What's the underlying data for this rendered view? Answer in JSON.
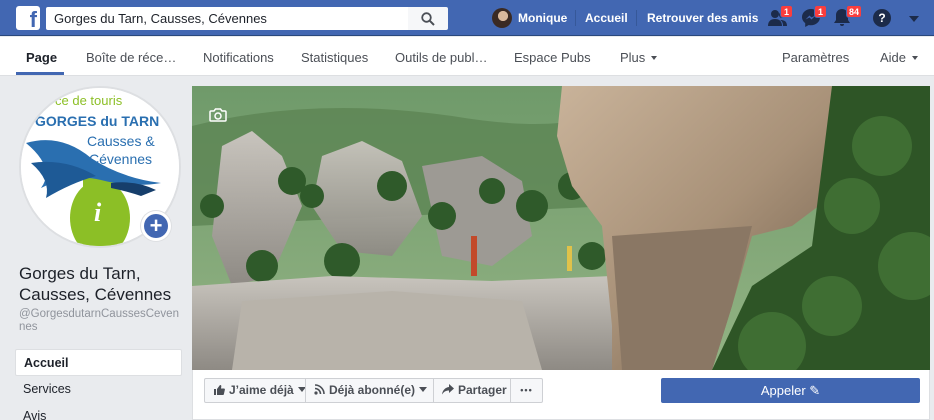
{
  "topbar": {
    "logo": "f",
    "search_value": "Gorges du Tarn, Causses, Cévennes",
    "user_name": "Monique",
    "home_label": "Accueil",
    "find_friends_label": "Retrouver des amis",
    "friend_requests_count": "1",
    "messages_count": "1",
    "notifications_count": "84",
    "help_symbol": "?"
  },
  "tabs": [
    {
      "label": "Page"
    },
    {
      "label": "Boîte de réce…"
    },
    {
      "label": "Notifications"
    },
    {
      "label": "Statistiques"
    },
    {
      "label": "Outils de publ…"
    },
    {
      "label": "Espace Pubs"
    },
    {
      "label": "Plus"
    },
    {
      "label": "Paramètres"
    },
    {
      "label": "Aide"
    }
  ],
  "profile": {
    "logo_top_text": "ce de touris",
    "logo_title": "GORGES du TARN",
    "logo_line2": "Causses &",
    "logo_line3": "Cévennes",
    "logo_info": "i",
    "page_name": "Gorges du Tarn, Causses, Cévennes",
    "handle": "@GorgesdutarnCaussesCevennes",
    "plus_symbol": "+"
  },
  "left_nav": [
    {
      "label": "Accueil"
    },
    {
      "label": "Services"
    },
    {
      "label": "Avis"
    }
  ],
  "actions": {
    "like_label": "J’aime déjà",
    "follow_label": "Déjà abonné(e)",
    "share_label": "Partager",
    "more_label": "•••",
    "call_label": "Appeler ✎"
  },
  "colors": {
    "brand_blue": "#4267b2",
    "badge_red": "#fa3e3e",
    "logo_green": "#8cbf26",
    "logo_blue": "#2a6fb0"
  }
}
